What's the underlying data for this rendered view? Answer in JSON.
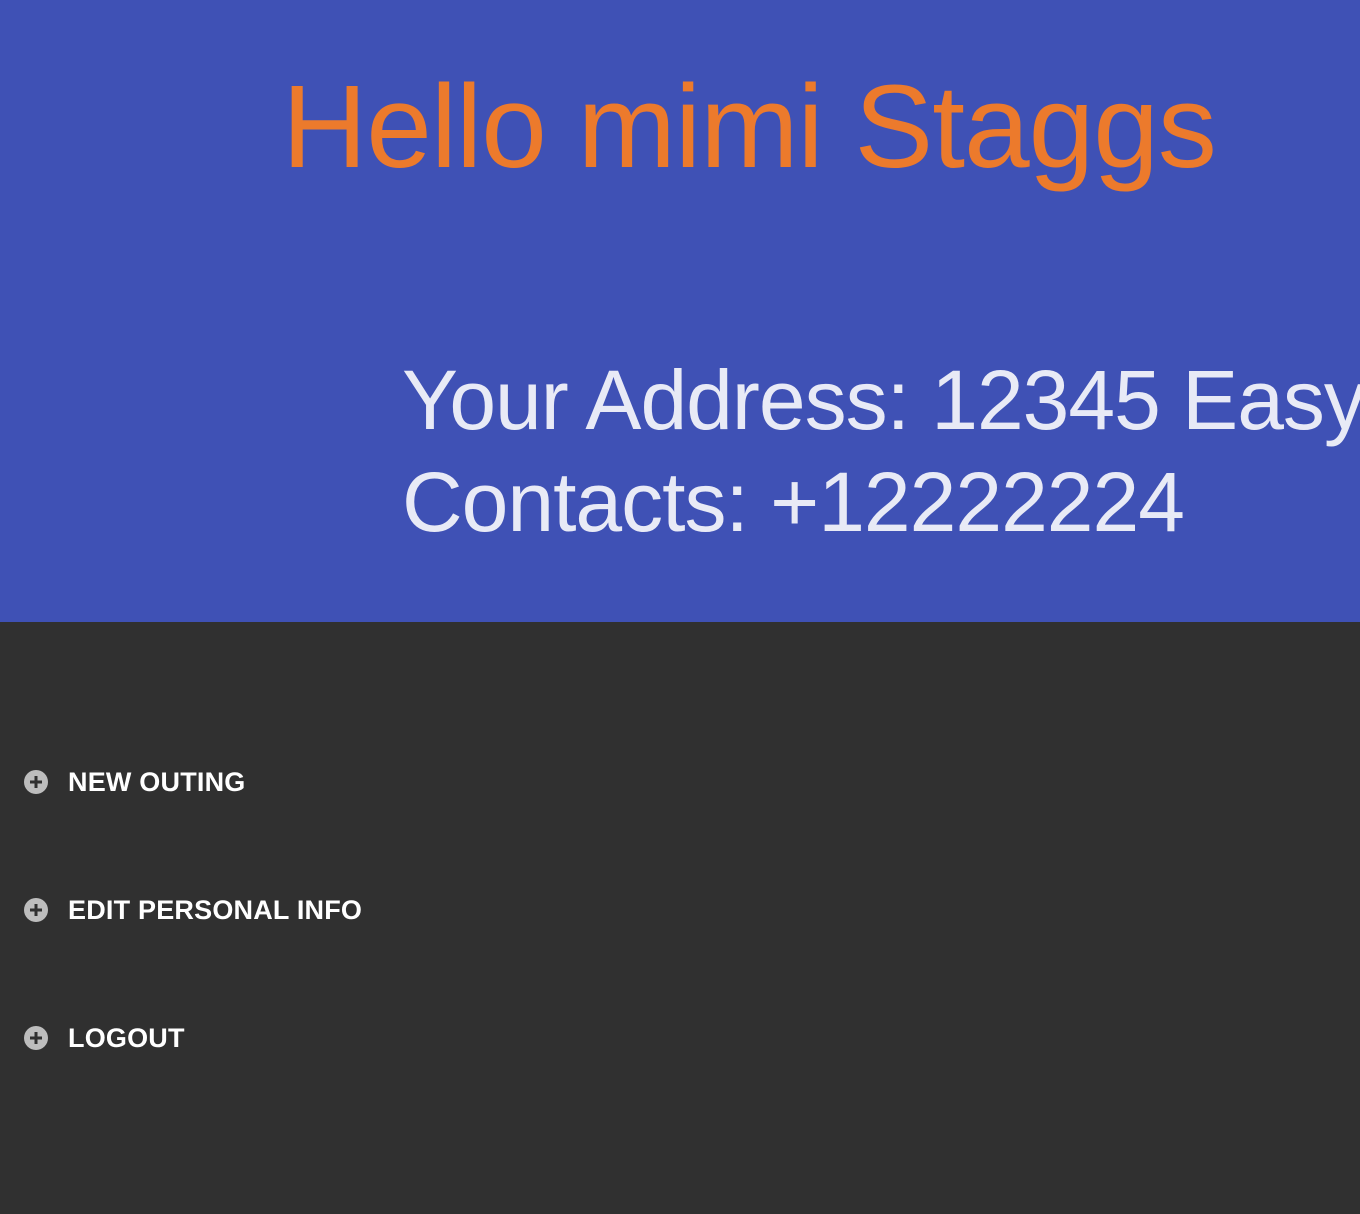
{
  "header": {
    "greeting": "Hello mimi Staggs",
    "address_line": "Your Address: 12345 Easy",
    "contacts_line": "Contacts: +12222224"
  },
  "menu": {
    "items": [
      {
        "label": "NEW OUTING",
        "icon": "plus-circle-icon"
      },
      {
        "label": "EDIT PERSONAL INFO",
        "icon": "plus-circle-icon"
      },
      {
        "label": "LOGOUT",
        "icon": "plus-circle-icon"
      }
    ]
  },
  "colors": {
    "header_background": "#3f51b5",
    "greeting_text": "#ec7a2c",
    "info_text": "#e8eaf6",
    "menu_background": "#303030",
    "menu_text": "#ffffff",
    "icon_fill": "#bdbdbd"
  }
}
